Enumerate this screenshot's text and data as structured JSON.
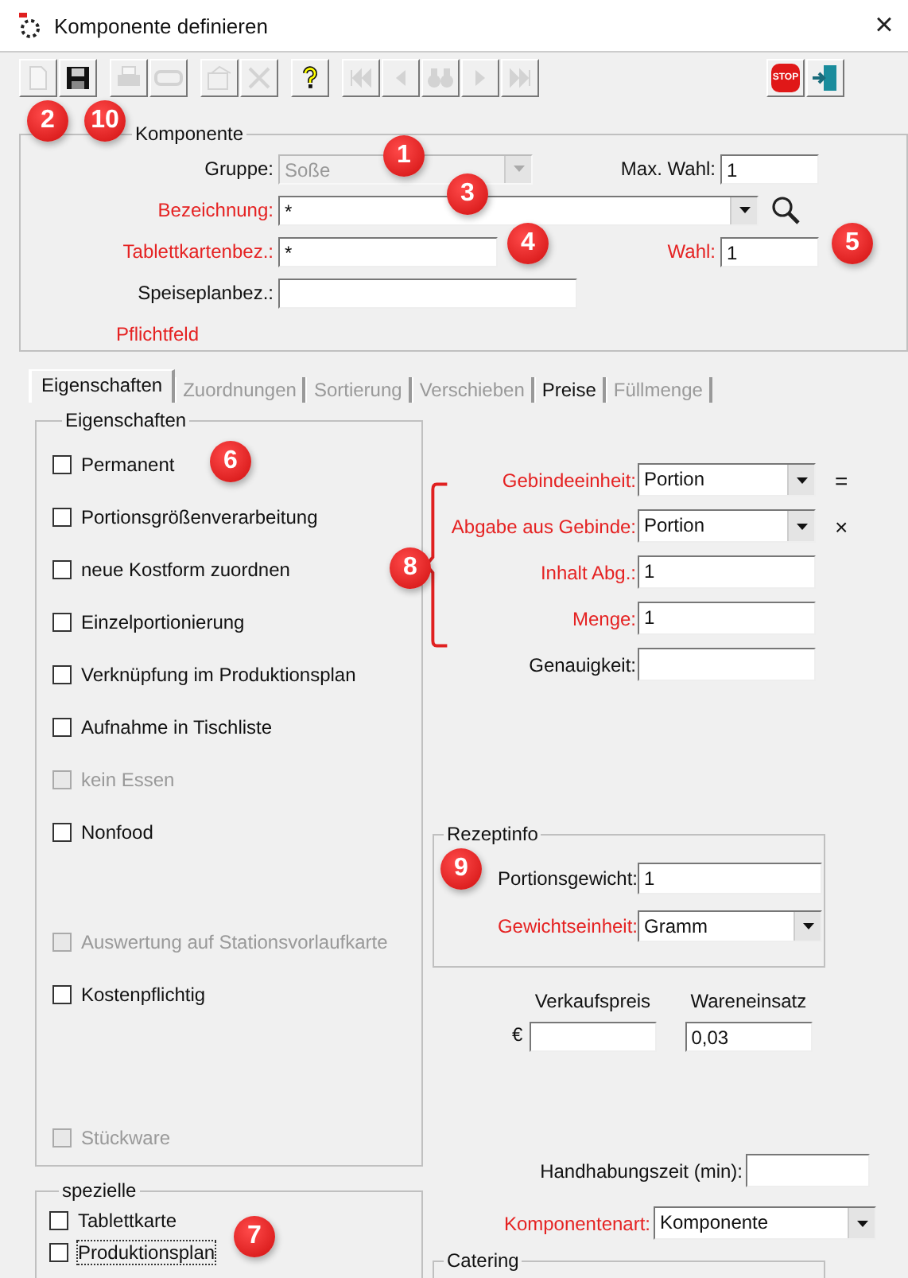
{
  "window": {
    "title": "Komponente definieren",
    "close": "×"
  },
  "toolbar": {
    "groups": [
      [
        {
          "kind": "new",
          "disabled": true
        },
        {
          "kind": "save",
          "disabled": false
        }
      ],
      [
        {
          "kind": "print",
          "disabled": true
        },
        {
          "kind": "tape",
          "disabled": true
        }
      ],
      [
        {
          "kind": "properties",
          "disabled": true
        },
        {
          "kind": "delete",
          "disabled": true
        }
      ],
      [
        {
          "kind": "help",
          "disabled": false
        }
      ],
      [
        {
          "kind": "first",
          "disabled": true
        },
        {
          "kind": "prev",
          "disabled": true
        },
        {
          "kind": "find",
          "disabled": true
        },
        {
          "kind": "next",
          "disabled": true
        },
        {
          "kind": "last",
          "disabled": true
        }
      ]
    ],
    "right": [
      {
        "kind": "stop",
        "label": "STOP",
        "disabled": false
      },
      {
        "kind": "exit",
        "disabled": false
      }
    ]
  },
  "komponente": {
    "title": "Komponente",
    "rows": [
      {
        "label": "Gruppe:",
        "kind": "combo",
        "value": "Soße",
        "required": false,
        "disabled": true,
        "extra": {
          "label": "Max. Wahl:",
          "value": "1",
          "required": false
        }
      },
      {
        "label": "Bezeichnung:",
        "kind": "combo",
        "value": "*",
        "required": true,
        "disabled": false,
        "search": true
      },
      {
        "label": "Tablettkartenbez.:",
        "kind": "text",
        "value": "*",
        "required": true,
        "disabled": false,
        "extra": {
          "label": "Wahl:",
          "value": "1",
          "required": true
        }
      },
      {
        "label": "Speiseplanbez.:",
        "kind": "text",
        "required": false,
        "disabled": false
      }
    ],
    "note": "Pflichtfeld"
  },
  "tabs": [
    {
      "label": "Eigenschaften",
      "selected": true,
      "disabled": false
    },
    {
      "label": "Zuordnungen",
      "selected": false,
      "disabled": true
    },
    {
      "label": "Sortierung",
      "selected": false,
      "disabled": true
    },
    {
      "label": "Verschieben",
      "selected": false,
      "disabled": true
    },
    {
      "label": "Preise",
      "selected": false,
      "disabled": false
    },
    {
      "label": "Füllmenge",
      "selected": false,
      "disabled": true
    }
  ],
  "eigenschaften": {
    "title": "Eigenschaften",
    "items": [
      {
        "label": "Permanent",
        "checked": false,
        "disabled": false
      },
      {
        "label": "Portionsgrößenverarbeitung",
        "checked": false,
        "disabled": false
      },
      {
        "label": "neue Kostform zuordnen",
        "checked": false,
        "disabled": false
      },
      {
        "label": "Einzelportionierung",
        "checked": false,
        "disabled": false
      },
      {
        "label": "Verknüpfung im Produktionsplan",
        "checked": false,
        "disabled": false
      },
      {
        "label": "Aufnahme in Tischliste",
        "checked": false,
        "disabled": false
      },
      {
        "label": "kein Essen",
        "checked": false,
        "disabled": true
      },
      {
        "label": "Nonfood",
        "checked": false,
        "disabled": false
      },
      {
        "label": "Auswertung auf Stationsvorlaufkarte",
        "checked": false,
        "disabled": true
      },
      {
        "label": "Kostenpflichtig",
        "checked": false,
        "disabled": false
      },
      {
        "label": "Stückware",
        "checked": false,
        "disabled": true
      }
    ]
  },
  "spezielle": {
    "title": "spezielle",
    "items": [
      {
        "label": "Tablettkarte",
        "checked": false,
        "disabled": false,
        "focused": false
      },
      {
        "label": "Produktionsplan",
        "checked": false,
        "disabled": false,
        "focused": true
      }
    ]
  },
  "gebinde": {
    "rows": [
      {
        "label": "Gebindeeinheit:",
        "kind": "combo",
        "value": "Portion",
        "required": true,
        "sign": "="
      },
      {
        "label": "Abgabe aus Gebinde:",
        "kind": "combo",
        "value": "Portion",
        "required": true,
        "sign": "×"
      },
      {
        "label": "Inhalt Abg.:",
        "kind": "text",
        "value": "1",
        "required": true
      },
      {
        "label": "Menge:",
        "kind": "text",
        "value": "1",
        "required": true
      },
      {
        "label": "Genauigkeit:",
        "kind": "text",
        "required": false
      }
    ]
  },
  "rezeptinfo": {
    "title": "Rezeptinfo",
    "rows": [
      {
        "label": "Portionsgewicht:",
        "kind": "text",
        "value": "1",
        "required": false
      },
      {
        "label": "Gewichtseinheit:",
        "kind": "combo",
        "value": "Gramm",
        "required": true
      }
    ]
  },
  "preise": {
    "currency": "€",
    "columns": [
      {
        "label": "Verkaufspreis"
      },
      {
        "label": "Wareneinsatz",
        "value": "0,03"
      }
    ]
  },
  "handhabungszeit": {
    "label": "Handhabungszeit (min):"
  },
  "komponentenart": {
    "label": "Komponentenart:",
    "value": "Komponente",
    "required": true
  },
  "catering": {
    "title": "Catering"
  },
  "callouts": [
    "2",
    "10",
    "1",
    "3",
    "4",
    "5",
    "6",
    "8",
    "9",
    "7"
  ]
}
